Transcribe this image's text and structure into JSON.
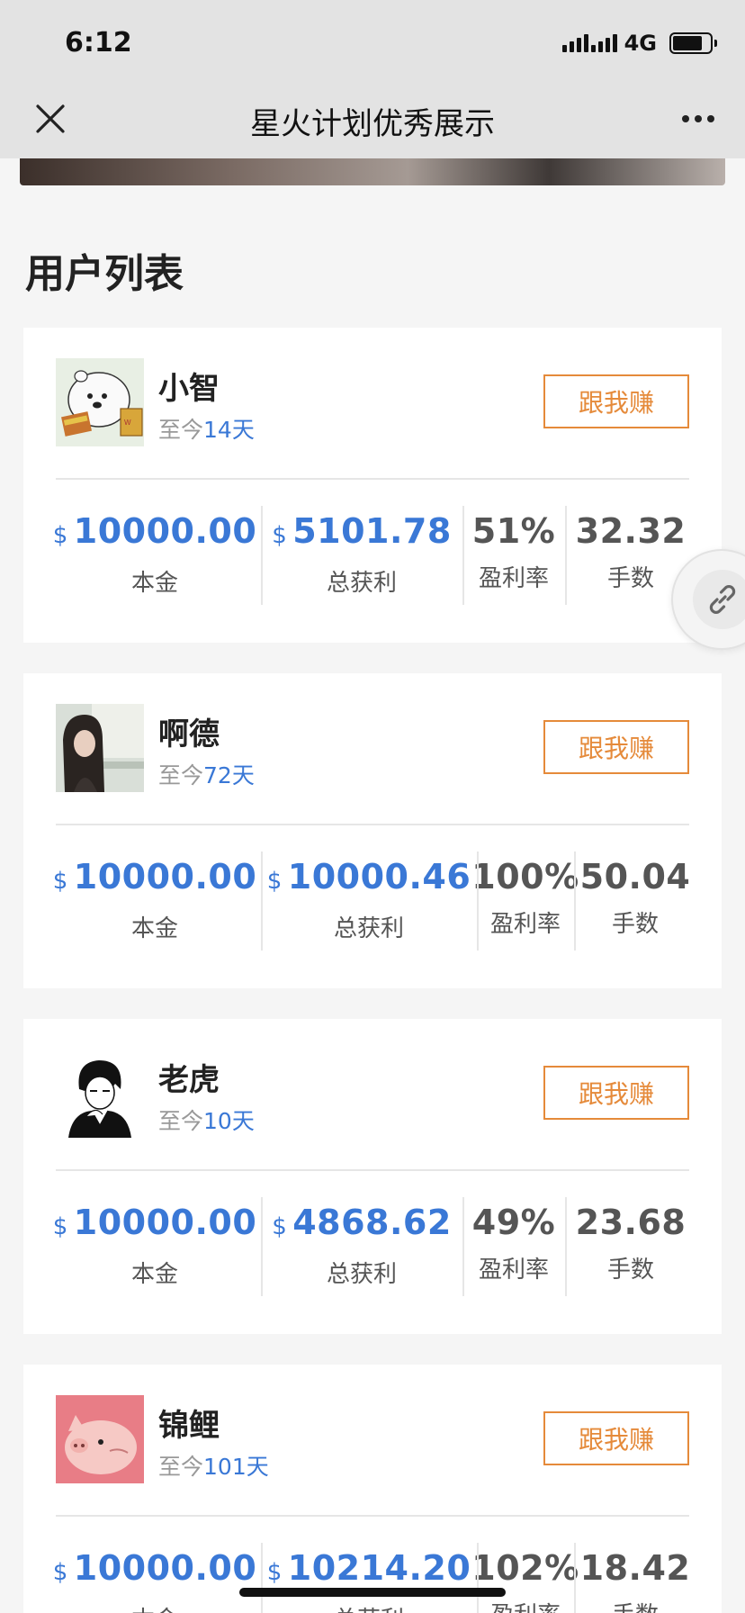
{
  "status": {
    "time": "6:12",
    "network": "4G",
    "battery_level": 0.8
  },
  "header": {
    "title": "星火计划优秀展示",
    "close_icon": "close-icon",
    "more_icon": "more-icon"
  },
  "section": {
    "title": "用户列表"
  },
  "labels": {
    "principal": "本金",
    "profit": "总获利",
    "rate": "盈利率",
    "lots": "手数",
    "currency": "$"
  },
  "users": [
    {
      "name": "小智",
      "since_prefix": "至今",
      "since_days": "14天",
      "follow_label": "跟我赚",
      "avatar": "polar-bear-avatar",
      "principal": "10000.00",
      "profit": "5101.78",
      "rate": "51%",
      "lots": "32.32"
    },
    {
      "name": "啊德",
      "since_prefix": "至今",
      "since_days": "72天",
      "follow_label": "跟我赚",
      "avatar": "girl-photo-avatar",
      "principal": "10000.00",
      "profit": "10000.46",
      "rate": "100%",
      "lots": "50.04"
    },
    {
      "name": "老虎",
      "since_prefix": "至今",
      "since_days": "10天",
      "follow_label": "跟我赚",
      "avatar": "manga-boy-avatar",
      "principal": "10000.00",
      "profit": "4868.62",
      "rate": "49%",
      "lots": "23.68"
    },
    {
      "name": "锦鲤",
      "since_prefix": "至今",
      "since_days": "101天",
      "follow_label": "跟我赚",
      "avatar": "pink-pig-avatar",
      "principal": "10000.00",
      "profit": "10214.20",
      "rate": "102%",
      "lots": "18.42"
    }
  ],
  "floating": {
    "icon": "link-icon"
  },
  "colors": {
    "accent_blue": "#3a78d6",
    "button_orange": "#e58a3a"
  }
}
